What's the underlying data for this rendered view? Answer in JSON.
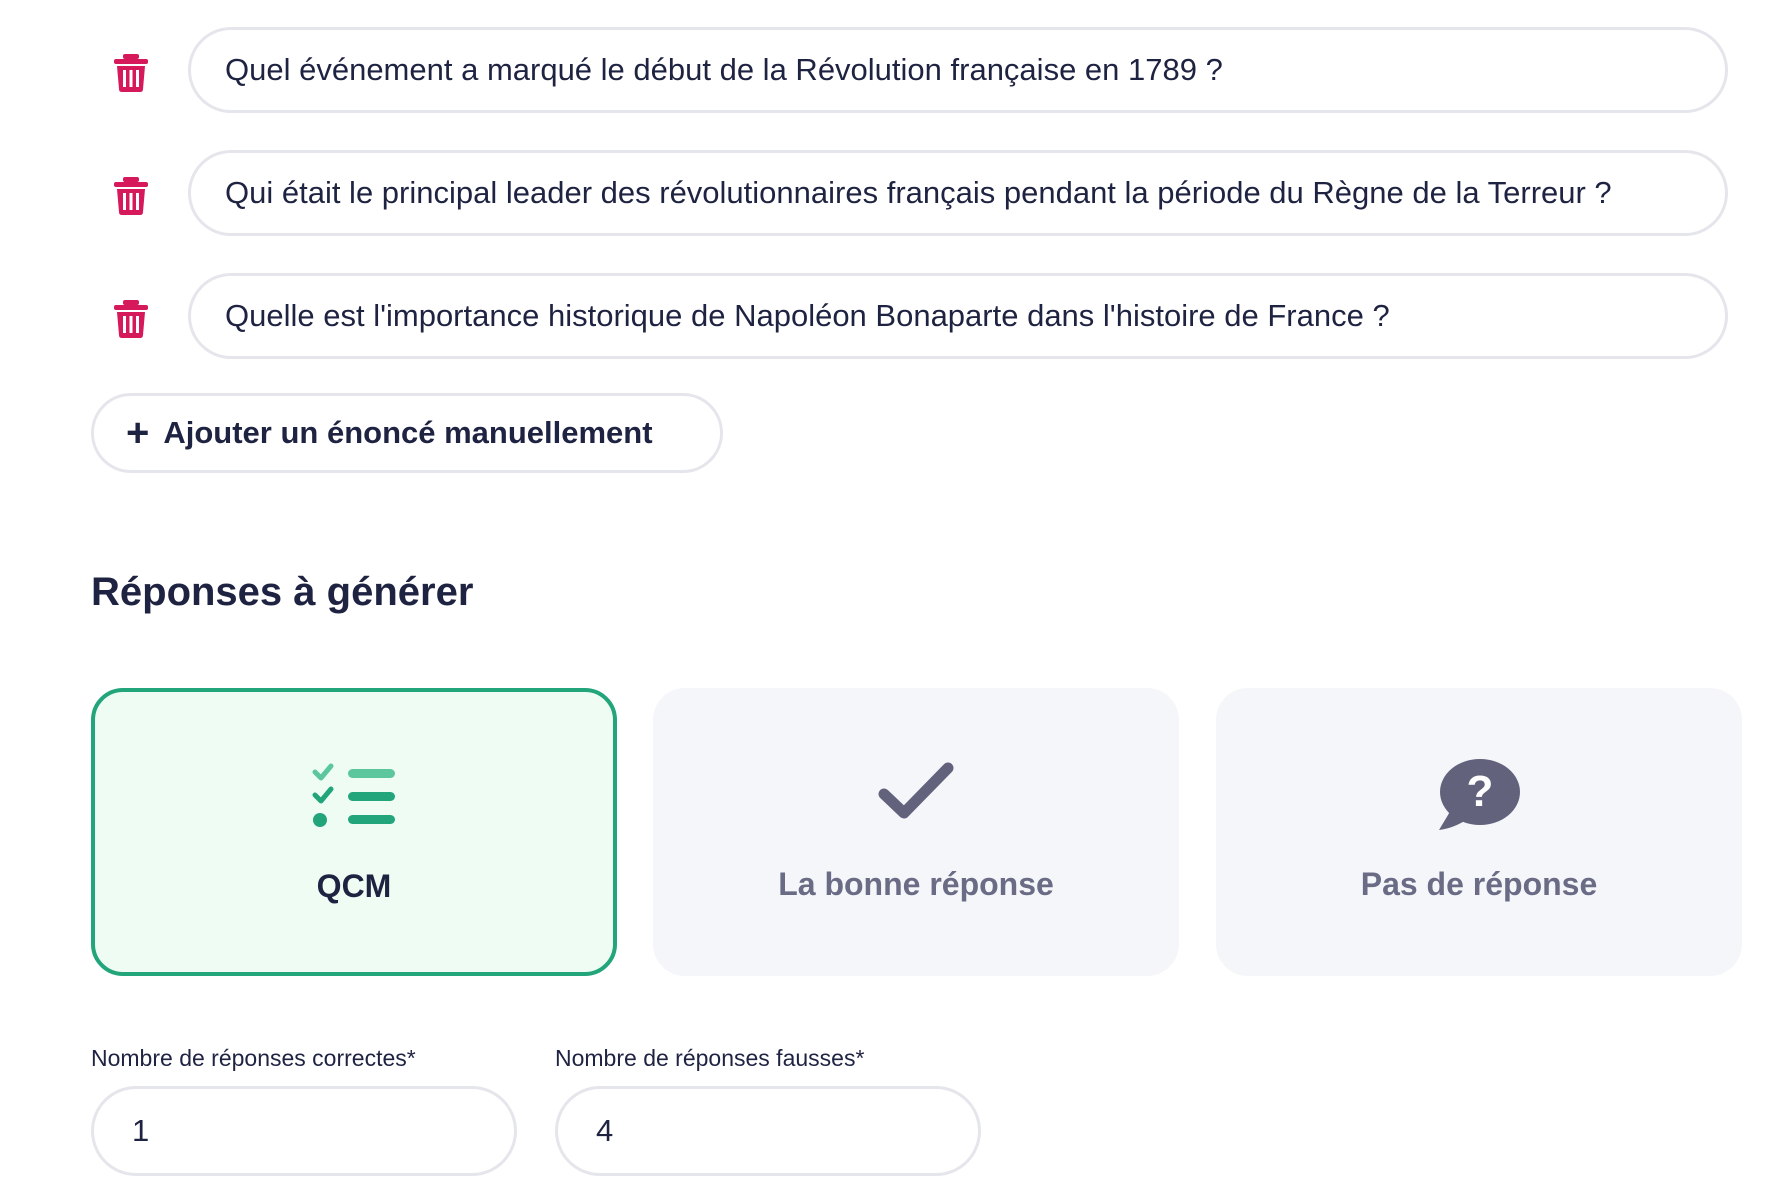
{
  "questions": [
    {
      "text": "Quel événement a marqué le début de la Révolution française en 1789 ?"
    },
    {
      "text": "Qui était le principal leader des révolutionnaires français pendant la période du Règne de la Terreur ?"
    },
    {
      "text": "Quelle est l'importance historique de Napoléon Bonaparte dans l'histoire de France ?"
    }
  ],
  "add_button": {
    "label": "Ajouter un énoncé manuellement",
    "icon": "plus-icon"
  },
  "section_title": "Réponses à générer",
  "answer_types": [
    {
      "label": "QCM",
      "icon": "checklist-icon",
      "selected": true
    },
    {
      "label": "La bonne réponse",
      "icon": "checkmark-icon",
      "selected": false
    },
    {
      "label": "Pas de réponse",
      "icon": "question-bubble-icon",
      "selected": false
    }
  ],
  "fields": {
    "correct": {
      "label": "Nombre de réponses correctes*",
      "value": "1"
    },
    "wrong": {
      "label": "Nombre de réponses fausses*",
      "value": "4"
    }
  },
  "colors": {
    "delete": "#d6195a",
    "accent": "#22a57a",
    "accent_light": "#5cc79c",
    "muted": "#62627c",
    "text": "#1f2342"
  }
}
